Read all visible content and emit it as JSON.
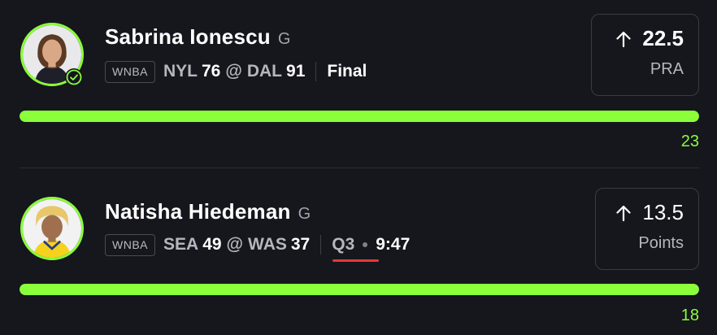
{
  "accent_color": "#8aff3a",
  "live_indicator_color": "#e53935",
  "picks": [
    {
      "player": {
        "name": "Sabrina Ionescu",
        "position": "G",
        "avatar_icon": "player-headshot-icon",
        "status_icon": "check-circle-icon"
      },
      "league": "WNBA",
      "game": {
        "away_team": "NYL",
        "away_score": "76",
        "at": "@",
        "home_team": "DAL",
        "home_score": "91",
        "status": "Final"
      },
      "line": {
        "direction_icon": "arrow-up-icon",
        "value": "22.5",
        "stat": "PRA"
      },
      "progress": {
        "current": "23",
        "fraction": 1.0
      }
    },
    {
      "player": {
        "name": "Natisha Hiedeman",
        "position": "G",
        "avatar_icon": "player-headshot-icon"
      },
      "league": "WNBA",
      "game": {
        "away_team": "SEA",
        "away_score": "49",
        "at": "@",
        "home_team": "WAS",
        "home_score": "37",
        "quarter": "Q3",
        "clock": "9:47"
      },
      "line": {
        "direction_icon": "arrow-up-icon",
        "value": "13.5",
        "stat": "Points"
      },
      "progress": {
        "current": "18",
        "fraction": 1.0
      }
    }
  ]
}
